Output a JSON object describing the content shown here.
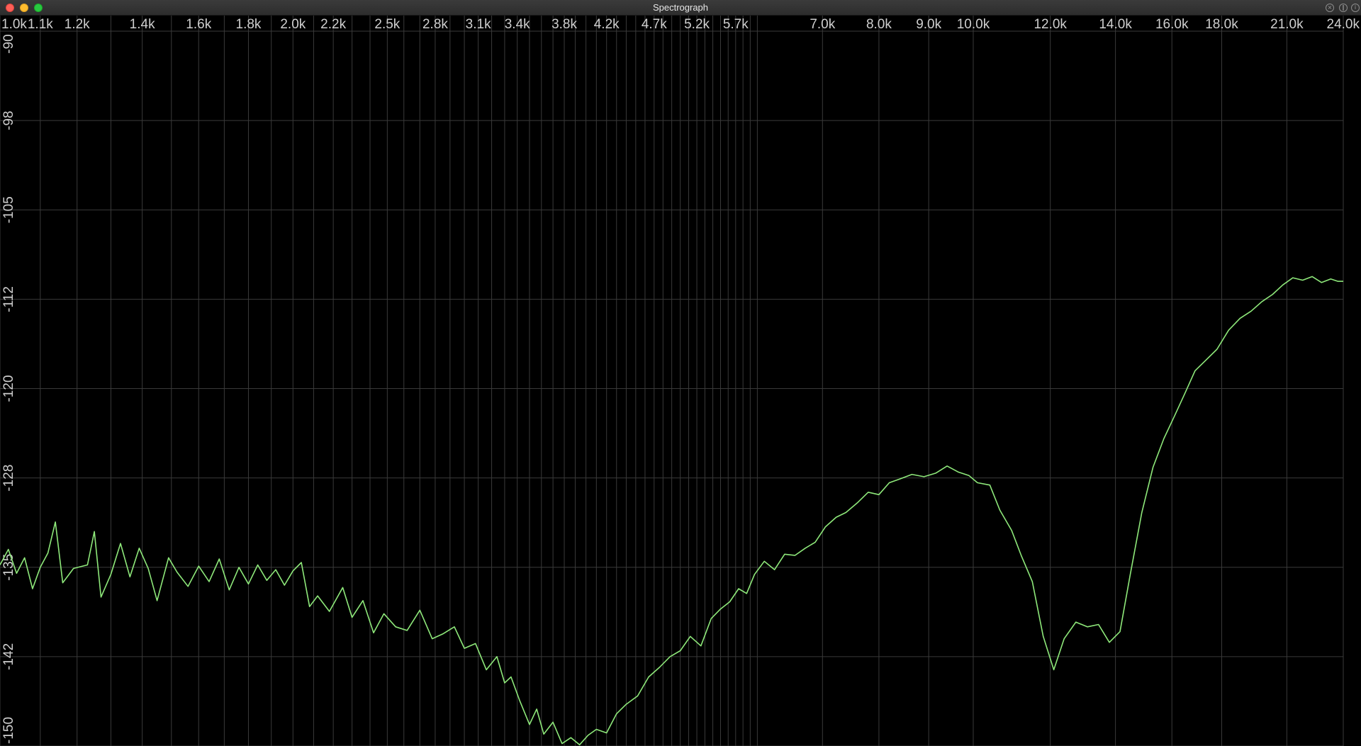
{
  "window": {
    "title": "Spectrograph",
    "controls": {
      "close_icon": "close-icon",
      "minimize_icon": "minimize-icon",
      "maximize_icon": "maximize-icon",
      "extra_buttons": [
        {
          "icon": "close-circle-icon",
          "glyph": "×"
        },
        {
          "icon": "pause-icon",
          "glyph": "∥"
        },
        {
          "icon": "info-icon",
          "glyph": "i"
        }
      ]
    }
  },
  "colors": {
    "background": "#000000",
    "grid": "#3a3a3a",
    "trace": "#8ee87a",
    "label": "#cfcfcf"
  },
  "chart_data": {
    "type": "line",
    "x_scale": "log",
    "xlim": [
      1000,
      24000
    ],
    "ylim": [
      -150,
      -90
    ],
    "x_tick_labels": [
      "1.0k",
      "1.1k",
      "1.2k",
      "1.4k",
      "1.6k",
      "1.8k",
      "2.0k",
      "2.2k",
      "2.5k",
      "2.8k",
      "3.1k",
      "3.4k",
      "3.8k",
      "4.2k",
      "4.7k",
      "5.2k",
      "5.7k",
      "7.0k",
      "8.0k",
      "9.0k",
      "10.0k",
      "12.0k",
      "14.0k",
      "16.0k",
      "18.0k",
      "21.0k",
      "24.0k"
    ],
    "x_tick_values": [
      1000,
      1100,
      1200,
      1400,
      1600,
      1800,
      2000,
      2200,
      2500,
      2800,
      3100,
      3400,
      3800,
      4200,
      4700,
      5200,
      5700,
      7000,
      8000,
      9000,
      10000,
      12000,
      14000,
      16000,
      18000,
      21000,
      24000
    ],
    "y_tick_labels": [
      "-90",
      "-98",
      "-105",
      "-112",
      "-120",
      "-128",
      "-135",
      "-142",
      "-150"
    ],
    "y_tick_values": [
      -90,
      -97.5,
      -105,
      -112.5,
      -120,
      -127.5,
      -135,
      -142.5,
      -150
    ],
    "series": [
      {
        "points": [
          [
            1000,
            -134.8
          ],
          [
            1020,
            -133.5
          ],
          [
            1040,
            -135.5
          ],
          [
            1060,
            -134.2
          ],
          [
            1080,
            -136.8
          ],
          [
            1100,
            -135.0
          ],
          [
            1120,
            -133.8
          ],
          [
            1140,
            -131.2
          ],
          [
            1160,
            -136.3
          ],
          [
            1190,
            -135.1
          ],
          [
            1230,
            -134.8
          ],
          [
            1250,
            -132.0
          ],
          [
            1270,
            -137.5
          ],
          [
            1300,
            -135.6
          ],
          [
            1330,
            -133.0
          ],
          [
            1360,
            -135.8
          ],
          [
            1390,
            -133.4
          ],
          [
            1420,
            -135.1
          ],
          [
            1450,
            -137.8
          ],
          [
            1490,
            -134.2
          ],
          [
            1520,
            -135.4
          ],
          [
            1560,
            -136.6
          ],
          [
            1600,
            -134.9
          ],
          [
            1640,
            -136.2
          ],
          [
            1680,
            -134.3
          ],
          [
            1720,
            -136.9
          ],
          [
            1760,
            -135.0
          ],
          [
            1800,
            -136.4
          ],
          [
            1840,
            -134.8
          ],
          [
            1880,
            -136.1
          ],
          [
            1920,
            -135.2
          ],
          [
            1960,
            -136.5
          ],
          [
            2000,
            -135.3
          ],
          [
            2040,
            -134.6
          ],
          [
            2080,
            -138.3
          ],
          [
            2120,
            -137.4
          ],
          [
            2180,
            -138.7
          ],
          [
            2250,
            -136.7
          ],
          [
            2300,
            -139.2
          ],
          [
            2360,
            -137.8
          ],
          [
            2420,
            -140.5
          ],
          [
            2480,
            -138.9
          ],
          [
            2550,
            -140.0
          ],
          [
            2620,
            -140.3
          ],
          [
            2700,
            -138.6
          ],
          [
            2780,
            -141.0
          ],
          [
            2850,
            -140.6
          ],
          [
            2930,
            -140.0
          ],
          [
            3000,
            -141.8
          ],
          [
            3080,
            -141.4
          ],
          [
            3160,
            -143.6
          ],
          [
            3240,
            -142.5
          ],
          [
            3300,
            -144.7
          ],
          [
            3350,
            -144.2
          ],
          [
            3420,
            -146.2
          ],
          [
            3500,
            -148.2
          ],
          [
            3560,
            -146.9
          ],
          [
            3620,
            -149.0
          ],
          [
            3700,
            -148.0
          ],
          [
            3780,
            -149.8
          ],
          [
            3860,
            -149.3
          ],
          [
            3940,
            -149.9
          ],
          [
            4020,
            -149.1
          ],
          [
            4100,
            -148.6
          ],
          [
            4200,
            -148.9
          ],
          [
            4300,
            -147.3
          ],
          [
            4400,
            -146.5
          ],
          [
            4520,
            -145.8
          ],
          [
            4640,
            -144.2
          ],
          [
            4760,
            -143.4
          ],
          [
            4880,
            -142.5
          ],
          [
            5000,
            -142.0
          ],
          [
            5120,
            -140.8
          ],
          [
            5250,
            -141.6
          ],
          [
            5380,
            -139.3
          ],
          [
            5500,
            -138.5
          ],
          [
            5620,
            -137.9
          ],
          [
            5740,
            -136.8
          ],
          [
            5850,
            -137.2
          ],
          [
            5960,
            -135.6
          ],
          [
            6100,
            -134.5
          ],
          [
            6250,
            -135.2
          ],
          [
            6400,
            -133.9
          ],
          [
            6560,
            -134.0
          ],
          [
            6720,
            -133.4
          ],
          [
            6880,
            -132.9
          ],
          [
            7050,
            -131.6
          ],
          [
            7230,
            -130.8
          ],
          [
            7400,
            -130.4
          ],
          [
            7600,
            -129.6
          ],
          [
            7800,
            -128.7
          ],
          [
            8000,
            -128.9
          ],
          [
            8200,
            -127.9
          ],
          [
            8400,
            -127.6
          ],
          [
            8650,
            -127.2
          ],
          [
            8900,
            -127.4
          ],
          [
            9150,
            -127.1
          ],
          [
            9400,
            -126.5
          ],
          [
            9650,
            -127.0
          ],
          [
            9900,
            -127.3
          ],
          [
            10100,
            -127.9
          ],
          [
            10400,
            -128.1
          ],
          [
            10650,
            -130.2
          ],
          [
            10950,
            -131.9
          ],
          [
            11200,
            -134.0
          ],
          [
            11500,
            -136.2
          ],
          [
            11800,
            -140.8
          ],
          [
            12100,
            -143.6
          ],
          [
            12400,
            -141.0
          ],
          [
            12750,
            -139.6
          ],
          [
            13100,
            -140.0
          ],
          [
            13450,
            -139.8
          ],
          [
            13800,
            -141.3
          ],
          [
            14150,
            -140.4
          ],
          [
            14500,
            -135.6
          ],
          [
            14900,
            -130.4
          ],
          [
            15300,
            -126.6
          ],
          [
            15700,
            -124.2
          ],
          [
            16100,
            -122.3
          ],
          [
            16500,
            -120.4
          ],
          [
            16900,
            -118.5
          ],
          [
            17350,
            -117.6
          ],
          [
            17800,
            -116.7
          ],
          [
            18300,
            -115.1
          ],
          [
            18800,
            -114.1
          ],
          [
            19300,
            -113.5
          ],
          [
            19800,
            -112.7
          ],
          [
            20300,
            -112.1
          ],
          [
            20800,
            -111.3
          ],
          [
            21300,
            -110.7
          ],
          [
            21800,
            -110.9
          ],
          [
            22300,
            -110.6
          ],
          [
            22800,
            -111.1
          ],
          [
            23300,
            -110.8
          ],
          [
            23700,
            -111.0
          ],
          [
            24000,
            -111.0
          ]
        ]
      }
    ]
  }
}
